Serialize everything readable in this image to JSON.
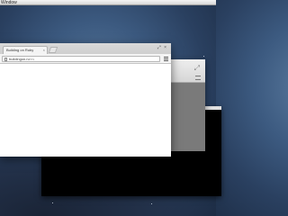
{
  "menubar": {
    "label": "Window"
  },
  "front_window": {
    "tab_title": "Building on Ruby",
    "url_host": "buildingon.ru",
    "url_path": "/ns",
    "tab_close": "×",
    "window_controls": "⤢ ×"
  },
  "gray_window": {
    "window_controls": "⤢"
  }
}
